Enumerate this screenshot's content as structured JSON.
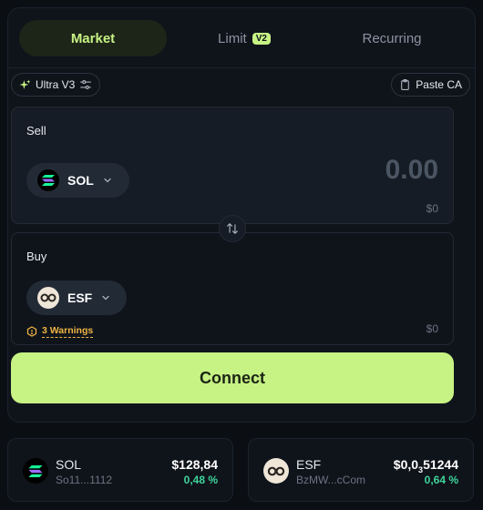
{
  "tabs": [
    {
      "label": "Market",
      "active": true
    },
    {
      "label": "Limit",
      "badge": "V2",
      "active": false
    },
    {
      "label": "Recurring",
      "active": false
    }
  ],
  "toolbar": {
    "ultra_label": "Ultra V3",
    "paste_label": "Paste CA"
  },
  "sell": {
    "label": "Sell",
    "token": "SOL",
    "amount": "0.00",
    "usd": "$0"
  },
  "buy": {
    "label": "Buy",
    "token": "ESF",
    "warnings": "3 Warnings",
    "usd": "$0"
  },
  "connect_label": "Connect",
  "markets": [
    {
      "name": "SOL",
      "address": "So11...1112",
      "price": "$128,84",
      "change": "0,48 %"
    },
    {
      "name": "ESF",
      "address": "BzMW...cCom",
      "price_prefix": "$0,0",
      "price_sub": "3",
      "price_suffix": "51244",
      "change": "0,64 %"
    }
  ],
  "colors": {
    "accent": "#c7f284",
    "positive": "#3fd49a",
    "warning": "#f0b444"
  },
  "icons": [
    "sparkle-icon",
    "settings-sliders-icon",
    "clipboard-icon",
    "chevron-down-icon",
    "swap-arrows-icon",
    "warning-icon",
    "sol-token-icon",
    "esf-token-icon"
  ]
}
